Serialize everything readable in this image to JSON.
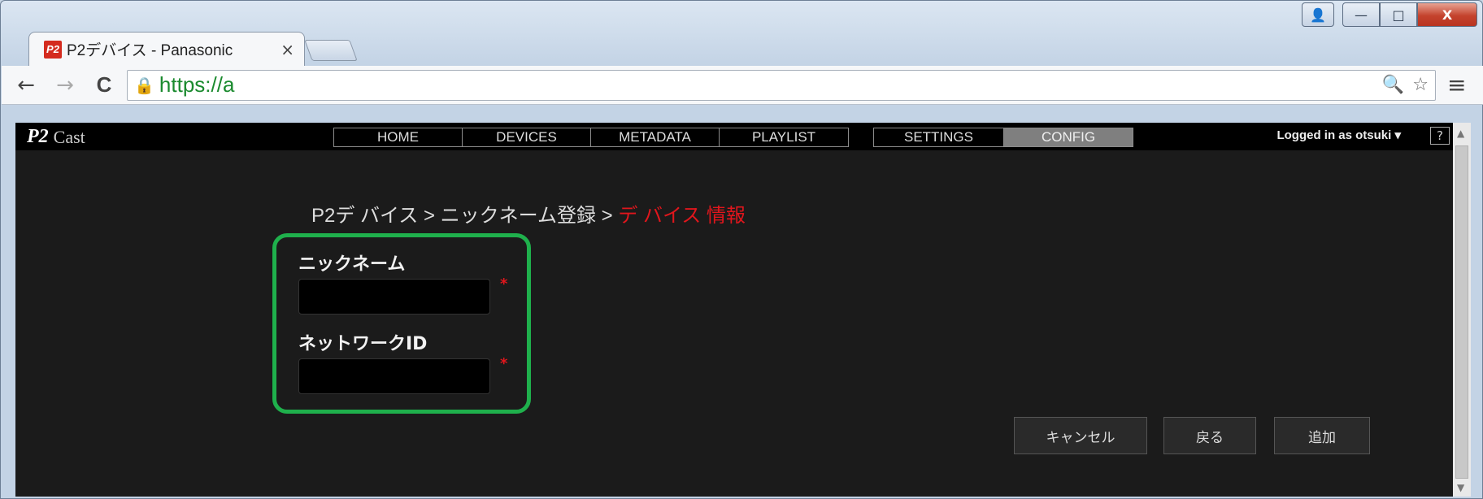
{
  "browser": {
    "tab_title": "P2デバイス - Panasonic",
    "tab_favicon": "P2",
    "tab_close": "×",
    "url": "https://a",
    "back_icon": "←",
    "forward_icon": "→",
    "reload_icon": "C",
    "zoom_icon": "zoom-icon",
    "star_icon": "☆",
    "menu_icon": "≡",
    "window_controls": {
      "minimize": "—",
      "maximize": "□",
      "close": "X"
    }
  },
  "app": {
    "logo_p2": "P2",
    "logo_cast": "Cast",
    "nav_left": [
      "HOME",
      "DEVICES",
      "METADATA",
      "PLAYLIST"
    ],
    "nav_right": [
      "SETTINGS",
      "CONFIG"
    ],
    "active_nav": "CONFIG",
    "user_label": "Logged in as otsuki ▾",
    "help_label": "?"
  },
  "breadcrumb": {
    "part1": "P2デ バイス",
    "sep1": " > ",
    "part2": "ニックネーム登録",
    "sep2": " > ",
    "current": "デ バイス 情報"
  },
  "form": {
    "nickname_label": "ニックネーム",
    "nickname_value": "",
    "network_id_label": "ネットワークID",
    "network_id_value": "",
    "required_marker": "*"
  },
  "buttons": {
    "cancel": "キャンセル",
    "back": "戻る",
    "add": "追加"
  },
  "colors": {
    "accent_red": "#e0161c",
    "highlight_green": "#1fb04c",
    "background": "#1b1b1b"
  }
}
